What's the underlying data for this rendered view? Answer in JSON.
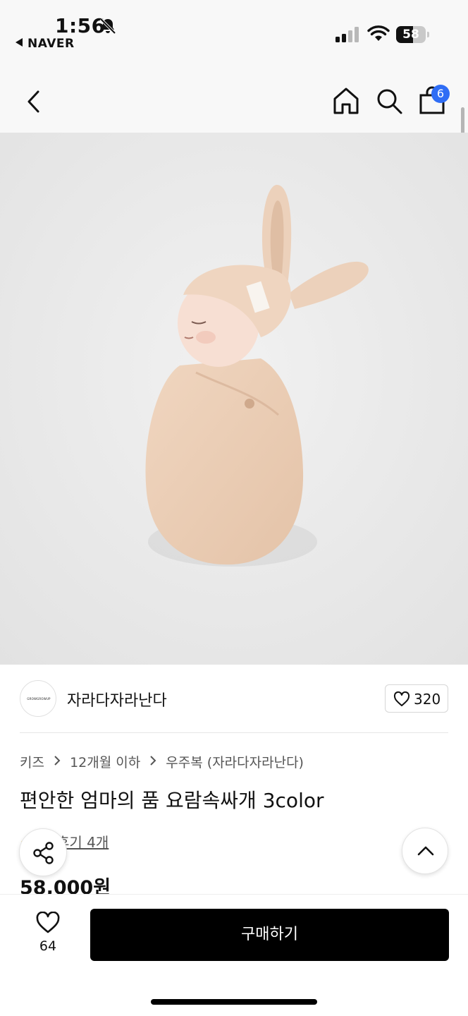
{
  "status_bar": {
    "time": "1:56",
    "back_app": "NAVER",
    "battery": "58",
    "battery_percent": 58,
    "icons": [
      "bell-off-icon",
      "signal-icon",
      "wifi-icon",
      "battery-icon"
    ]
  },
  "nav": {
    "icons": [
      "chevron-left-icon",
      "home-icon",
      "search-icon",
      "shopping-bag-icon"
    ],
    "cart_badge": "6"
  },
  "product_image": {
    "alt": "baby-in-swaddle-photo",
    "colors": {
      "background": "#ebebeb",
      "fabric": "#ebcdb4"
    }
  },
  "brand": {
    "name": "자라다자라난다",
    "logo_text": "GROWGROWUP",
    "like_count": "320"
  },
  "breadcrumb": [
    "키즈",
    "12개월 이하",
    "우주복 (자라다자라난다)"
  ],
  "product": {
    "title": "편안한 엄마의 품 요람속싸개 3color",
    "review_link": "후기 4개",
    "price": "58,000원"
  },
  "bottom_bar": {
    "wish_count": "64",
    "buy_label": "구매하기"
  },
  "colors": {
    "accent_badge": "#2f6df5",
    "buy_button": "#000000",
    "nav_background": "#f8f8f8"
  }
}
